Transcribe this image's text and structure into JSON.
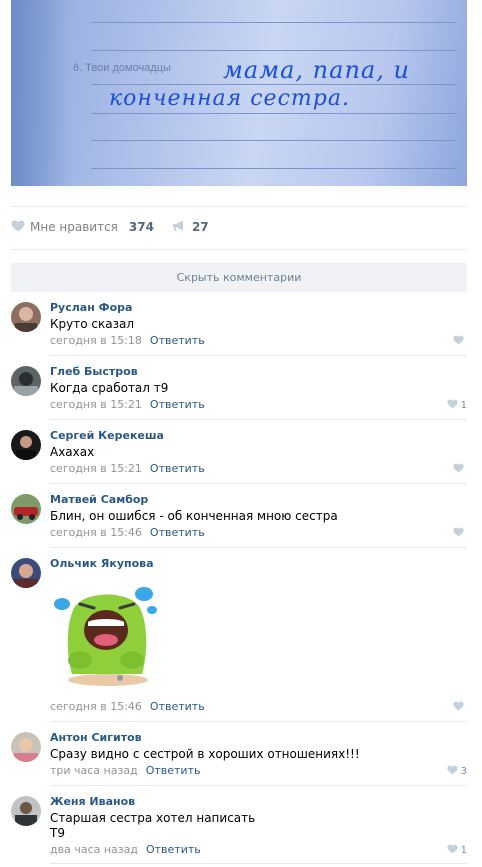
{
  "post": {
    "photo": {
      "printed_label": "6. Твои домочадцы",
      "handwriting_line1": "мама, папа, и",
      "handwriting_line2": "конченная сестра."
    },
    "likes_label": "Мне нравится",
    "likes_count": "374",
    "shares_count": "27"
  },
  "comments_toggle": "Скрыть комментарии",
  "comments": [
    {
      "author": "Руслан Фора",
      "text": "Круто сказал",
      "time": "сегодня в 15:18",
      "reply": "Ответить",
      "likes": ""
    },
    {
      "author": "Глеб Быстров",
      "text": "Когда сработал т9",
      "time": "сегодня в 15:21",
      "reply": "Ответить",
      "likes": "1"
    },
    {
      "author": "Сергей Керекеша",
      "text": "Ахахах",
      "time": "сегодня в 15:21",
      "reply": "Ответить",
      "likes": ""
    },
    {
      "author": "Матвей Самбор",
      "text": "Блин, он ошибся - об конченная мною сестра",
      "time": "сегодня в 15:46",
      "reply": "Ответить",
      "likes": ""
    },
    {
      "author": "Ольчик Якупова",
      "text": "",
      "time": "сегодня в 15:46",
      "reply": "Ответить",
      "likes": ""
    },
    {
      "author": "Антон Сигитов",
      "text": "Сразу видно с сестрой в хороших отношениях!!!",
      "time": "три часа назад",
      "reply": "Ответить",
      "likes": "3"
    },
    {
      "author": "Женя Иванов",
      "text_line1": "Старшая сестра хотел написать",
      "text_line2": "Т9",
      "time": "два часа назад",
      "reply": "Ответить",
      "likes": "1"
    }
  ],
  "icons": {
    "like": "heart-icon",
    "share": "megaphone-icon",
    "comment_like": "heart-icon",
    "sticker": "laughing-cactus-sticker"
  },
  "colors": {
    "link": "#2a5885",
    "meta": "#939393",
    "separator": "#e7e8ec"
  }
}
